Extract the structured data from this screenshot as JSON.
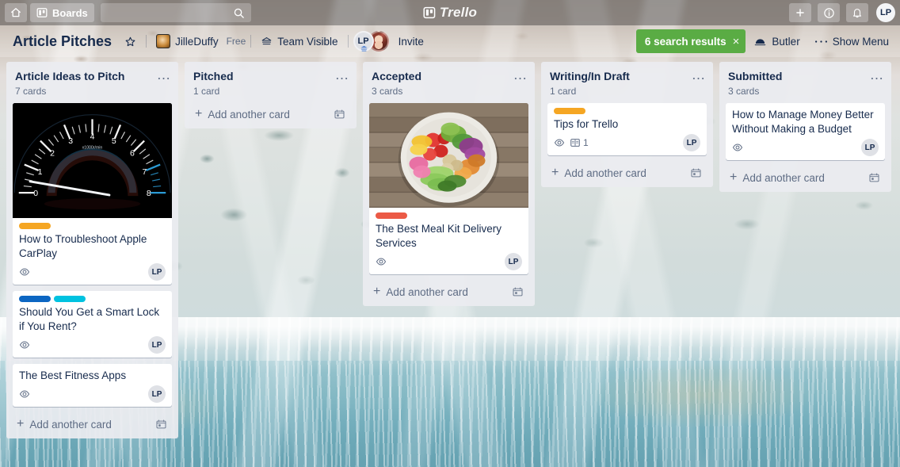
{
  "topbar": {
    "home_icon": "home-icon",
    "boards_label": "Boards",
    "search_placeholder": "",
    "search_value": "",
    "search_icon": "search-icon",
    "logo_text": "Trello",
    "add_icon": "plus-icon",
    "info_icon": "info-icon",
    "notifications_icon": "bell-icon",
    "user_initials": "LP"
  },
  "boardbar": {
    "title": "Article Pitches",
    "star_icon": "star-icon",
    "workspace_name": "JilleDuffy",
    "plan_label": "Free",
    "visibility_label": "Team Visible",
    "visibility_icon": "team-visible-icon",
    "members": [
      {
        "initials": "LP",
        "type": "initials",
        "admin_badge": true
      },
      {
        "initials": "",
        "type": "photo",
        "admin_badge": false
      }
    ],
    "invite_label": "Invite",
    "search_results_label": "6 search results",
    "search_results_close": "×",
    "butler_label": "Butler",
    "butler_icon": "butler-icon",
    "show_menu_label": "Show Menu",
    "show_menu_icon": "ellipsis-icon",
    "accent_green": "#5aac44"
  },
  "lists": [
    {
      "title": "Article Ideas to Pitch",
      "count": "7 cards",
      "menu_icon": "ellipsis-icon",
      "add_card_label": "Add another card",
      "template_icon": "card-template-icon",
      "cards": [
        {
          "title": "How to Troubleshoot Apple CarPlay",
          "cover": "tachometer",
          "cover_height": 145,
          "labels": [
            {
              "color": "#f5a623",
              "name": "orange-label"
            }
          ],
          "watch_icon": "watch-eye-icon",
          "description_count": "",
          "member": "LP"
        },
        {
          "title": "Should You Get a Smart Lock if You Rent?",
          "cover": "",
          "cover_height": 0,
          "labels": [
            {
              "color": "#0c66c2",
              "name": "blue-label"
            },
            {
              "color": "#00c2e0",
              "name": "sky-label"
            }
          ],
          "watch_icon": "watch-eye-icon",
          "description_count": "",
          "member": "LP"
        },
        {
          "title": "The Best Fitness Apps",
          "cover": "",
          "cover_height": 0,
          "labels": [],
          "watch_icon": "watch-eye-icon",
          "description_count": "",
          "member": "LP"
        }
      ]
    },
    {
      "title": "Pitched",
      "count": "1 card",
      "menu_icon": "ellipsis-icon",
      "add_card_label": "Add another card",
      "template_icon": "card-template-icon",
      "cards": []
    },
    {
      "title": "Accepted",
      "count": "3 cards",
      "menu_icon": "ellipsis-icon",
      "add_card_label": "Add another card",
      "template_icon": "card-template-icon",
      "cards": [
        {
          "title": "The Best Meal Kit Delivery Services",
          "cover": "salad-bowl",
          "cover_height": 132,
          "labels": [
            {
              "color": "#eb5a46",
              "name": "red-label"
            }
          ],
          "watch_icon": "watch-eye-icon",
          "description_count": "",
          "member": "LP"
        }
      ]
    },
    {
      "title": "Writing/In Draft",
      "count": "1 card",
      "menu_icon": "ellipsis-icon",
      "add_card_label": "Add another card",
      "template_icon": "card-template-icon",
      "cards": [
        {
          "title": "Tips for Trello",
          "cover": "",
          "cover_height": 0,
          "labels": [
            {
              "color": "#f5a623",
              "name": "orange-label"
            }
          ],
          "watch_icon": "watch-eye-icon",
          "description_count": "1",
          "member": "LP"
        }
      ]
    },
    {
      "title": "Submitted",
      "count": "3 cards",
      "menu_icon": "ellipsis-icon",
      "add_card_label": "Add another card",
      "template_icon": "card-template-icon",
      "cards": [
        {
          "title": "How to Manage Money Better Without Making a Budget",
          "cover": "",
          "cover_height": 0,
          "labels": [],
          "watch_icon": "watch-eye-icon",
          "description_count": "",
          "member": "LP"
        }
      ]
    }
  ]
}
